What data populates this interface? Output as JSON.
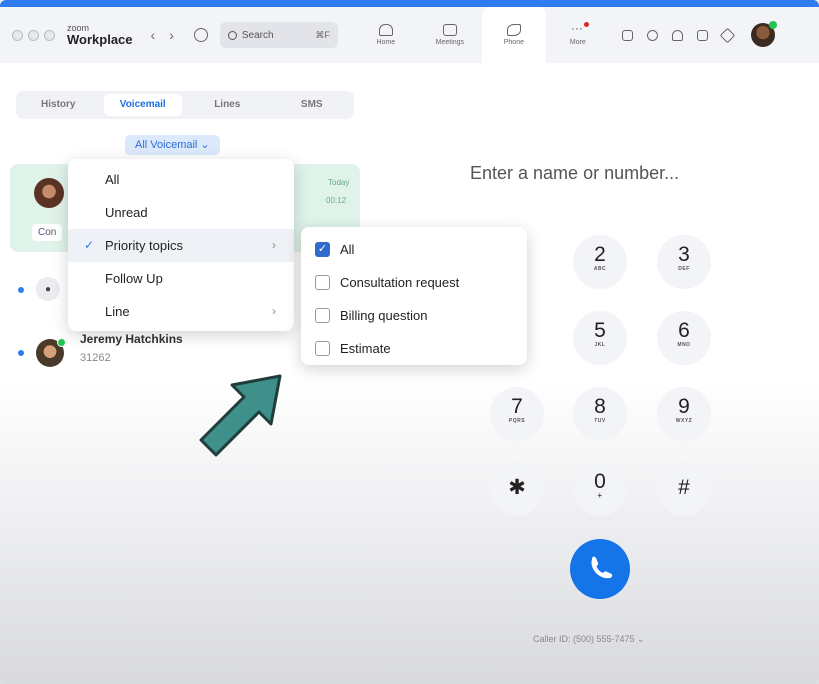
{
  "window": {
    "brand_small": "zoom",
    "brand_big": "Workplace",
    "back": "‹",
    "forward": "›",
    "search_label": "Search",
    "search_shortcut": "⌘F",
    "nav": [
      {
        "label": "Home"
      },
      {
        "label": "Meetings"
      },
      {
        "label": "Phone"
      },
      {
        "label": "More"
      }
    ]
  },
  "subtabs": [
    {
      "label": "History"
    },
    {
      "label": "Voicemail"
    },
    {
      "label": "Lines"
    },
    {
      "label": "SMS"
    }
  ],
  "filter": {
    "label": "All Voicemail ⌄"
  },
  "voicemail_card": {
    "badge": "Con",
    "today": "Today",
    "duration": "00:12"
  },
  "contacts": [
    {
      "name": "Jeremy Hatchkins",
      "number": "31262"
    }
  ],
  "menu": {
    "items": [
      {
        "label": "All"
      },
      {
        "label": "Unread"
      },
      {
        "label": "Priority topics",
        "check": "✓",
        "arrow": "›"
      },
      {
        "label": "Follow Up"
      },
      {
        "label": "Line",
        "arrow": "›"
      }
    ]
  },
  "submenu": {
    "items": [
      {
        "label": "All",
        "checked": "✓"
      },
      {
        "label": "Consultation request"
      },
      {
        "label": "Billing question"
      },
      {
        "label": "Estimate"
      }
    ]
  },
  "dialer": {
    "placeholder": "Enter a name or number...",
    "keys": [
      {
        "digit": "2",
        "letters": "ABC"
      },
      {
        "digit": "3",
        "letters": "DEF"
      },
      {
        "digit": "5",
        "letters": "JKL"
      },
      {
        "digit": "6",
        "letters": "MNO"
      },
      {
        "digit": "7",
        "letters": "PQRS"
      },
      {
        "digit": "8",
        "letters": "TUV"
      },
      {
        "digit": "9",
        "letters": "WXYZ"
      },
      {
        "digit": "✱",
        "letters": ""
      },
      {
        "digit": "0",
        "letters": "+"
      },
      {
        "digit": "#",
        "letters": ""
      }
    ],
    "caller_id": "Caller ID: (500) 555-7475 ⌄"
  },
  "colors": {
    "accent": "#1474e8",
    "arrow": "#3f8f8a",
    "card": "#dff3ea"
  }
}
